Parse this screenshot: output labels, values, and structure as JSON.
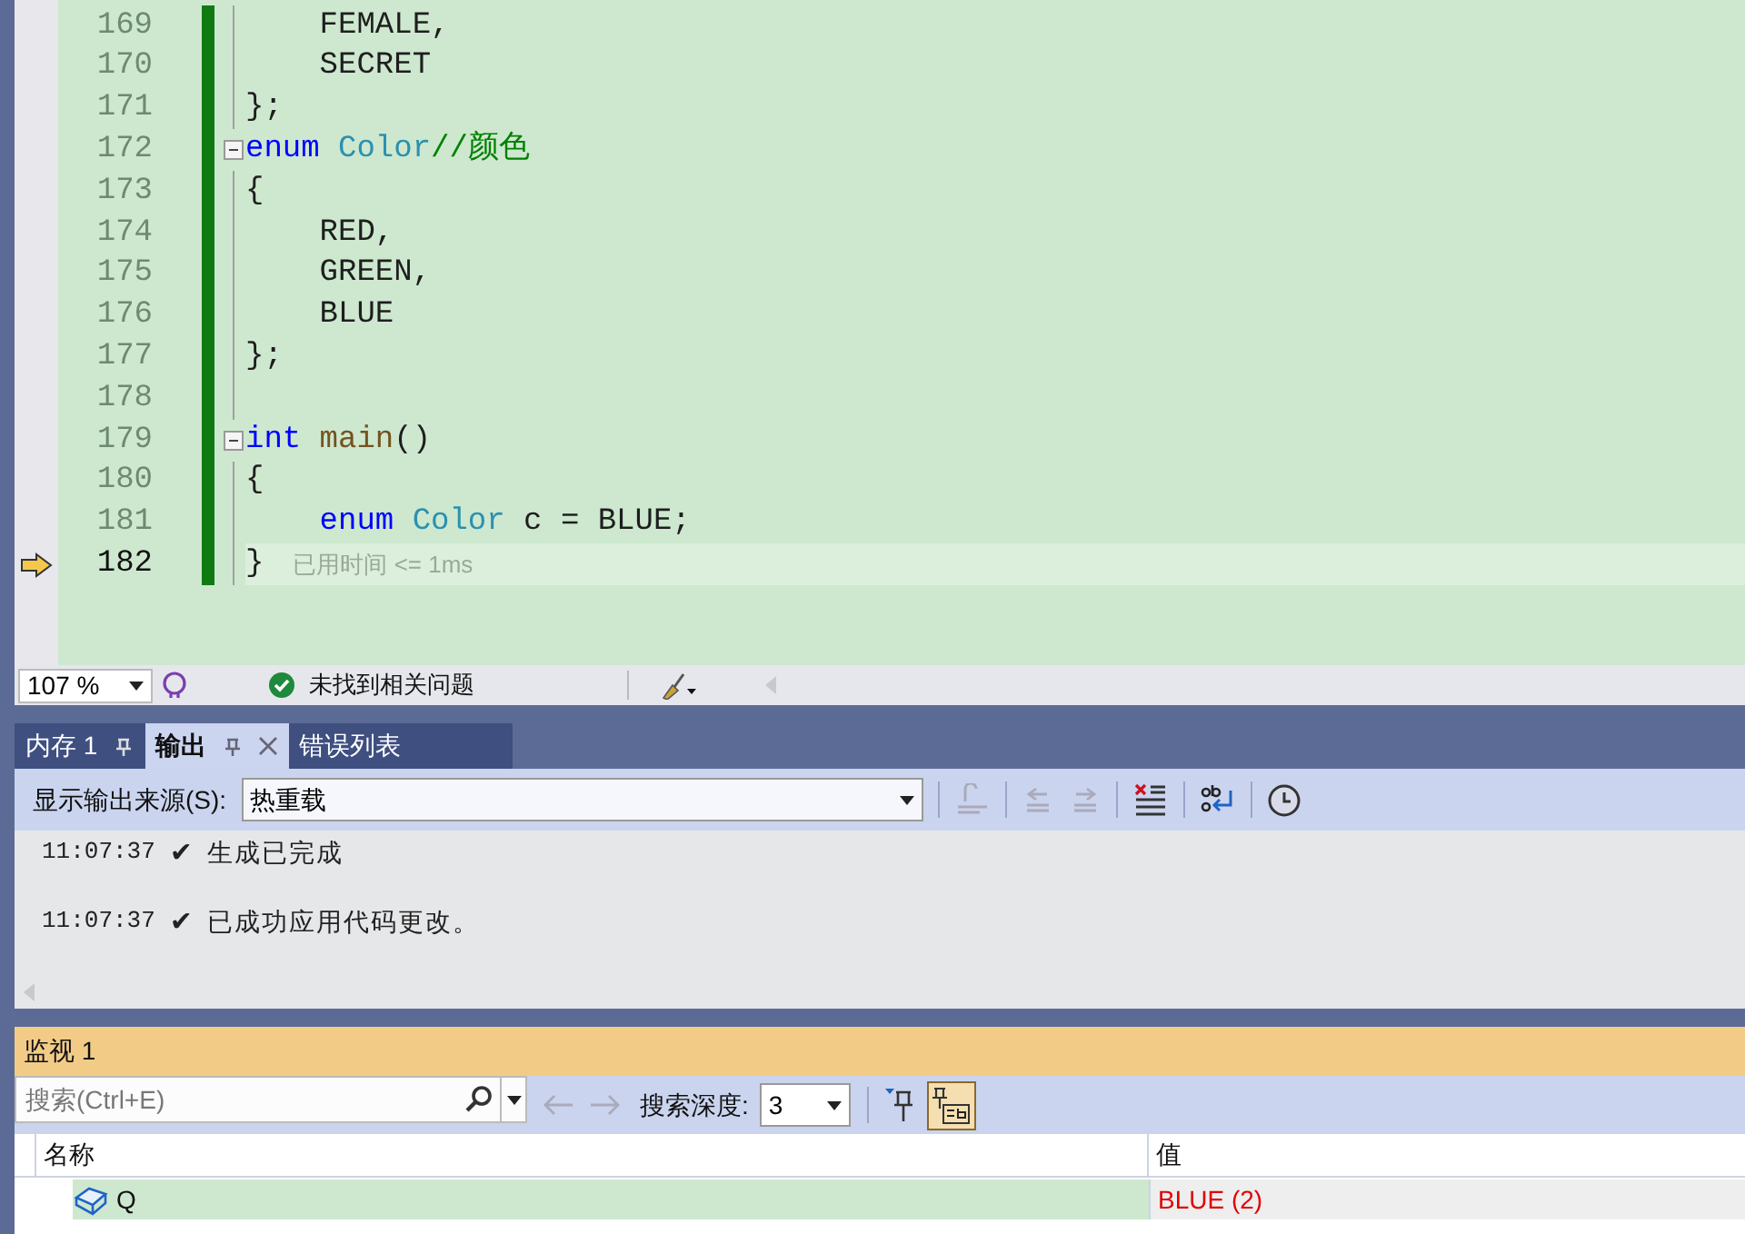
{
  "editor": {
    "lines": [
      {
        "number": "169",
        "fold_toggle": false,
        "current": false,
        "tokens": [
          {
            "kind": "plain",
            "text": "    FEMALE,"
          }
        ]
      },
      {
        "number": "170",
        "fold_toggle": false,
        "current": false,
        "tokens": [
          {
            "kind": "plain",
            "text": "    SECRET"
          }
        ]
      },
      {
        "number": "171",
        "fold_toggle": false,
        "current": false,
        "tokens": [
          {
            "kind": "plain",
            "text": "};"
          }
        ]
      },
      {
        "number": "172",
        "fold_toggle": true,
        "current": false,
        "tokens": [
          {
            "kind": "keyword",
            "text": "enum"
          },
          {
            "kind": "type",
            "text": " Color"
          },
          {
            "kind": "comment",
            "text": "//颜色"
          }
        ]
      },
      {
        "number": "173",
        "fold_toggle": false,
        "current": false,
        "tokens": [
          {
            "kind": "plain",
            "text": "{"
          }
        ]
      },
      {
        "number": "174",
        "fold_toggle": false,
        "current": false,
        "tokens": [
          {
            "kind": "plain",
            "text": "    RED,"
          }
        ]
      },
      {
        "number": "175",
        "fold_toggle": false,
        "current": false,
        "tokens": [
          {
            "kind": "plain",
            "text": "    GREEN,"
          }
        ]
      },
      {
        "number": "176",
        "fold_toggle": false,
        "current": false,
        "tokens": [
          {
            "kind": "plain",
            "text": "    BLUE"
          }
        ]
      },
      {
        "number": "177",
        "fold_toggle": false,
        "current": false,
        "tokens": [
          {
            "kind": "plain",
            "text": "};"
          }
        ]
      },
      {
        "number": "178",
        "fold_toggle": false,
        "current": false
      },
      {
        "number": "179",
        "fold_toggle": true,
        "current": false,
        "tokens": [
          {
            "kind": "keyword",
            "text": "int"
          },
          {
            "kind": "function",
            "text": " main"
          },
          {
            "kind": "plain",
            "text": "()"
          }
        ]
      },
      {
        "number": "180",
        "fold_toggle": false,
        "current": false,
        "tokens": [
          {
            "kind": "plain",
            "text": "{"
          }
        ]
      },
      {
        "number": "181",
        "fold_toggle": false,
        "current": false,
        "tokens": [
          {
            "kind": "keyword",
            "text": "    enum"
          },
          {
            "kind": "type",
            "text": " Color"
          },
          {
            "kind": "plain",
            "text": " c = BLUE;"
          }
        ]
      },
      {
        "number": "182",
        "fold_toggle": false,
        "current": true,
        "tokens": [
          {
            "kind": "plain",
            "text": "}"
          }
        ],
        "hint": "已用时间 <= 1ms"
      }
    ]
  },
  "status_bar": {
    "zoom": "107 %",
    "issues": "未找到相关问题"
  },
  "output_panel": {
    "tabs": [
      {
        "label": "内存 1",
        "selected": false,
        "closable": false
      },
      {
        "label": "输出",
        "selected": true,
        "closable": true
      },
      {
        "label": "错误列表",
        "selected": false,
        "closable": false
      }
    ],
    "source_label": "显示输出来源(S):",
    "source_value": "热重载",
    "messages": [
      {
        "time": "11:07:37",
        "mark": "✔",
        "text": "生成已完成"
      },
      {
        "time": "11:07:37",
        "mark": "✔",
        "text": "已成功应用代码更改。"
      }
    ]
  },
  "watch_panel": {
    "title": "监视 1",
    "search_placeholder": "搜索(Ctrl+E)",
    "depth_label": "搜索深度:",
    "depth_value": "3",
    "columns": [
      "名称",
      "值"
    ],
    "rows": [
      {
        "name": "Q",
        "value": "BLUE (2)"
      }
    ]
  }
}
